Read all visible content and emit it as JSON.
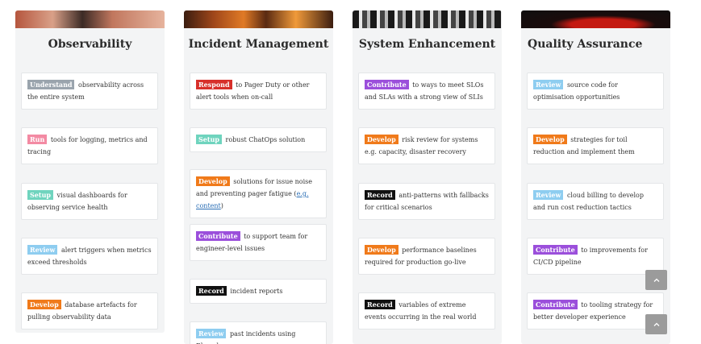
{
  "columns": [
    {
      "title": "Observability",
      "cards": [
        {
          "tag": "Understand",
          "text": "observability across the entire system"
        },
        {
          "tag": "Run",
          "text": "tools for logging, metrics and tracing"
        },
        {
          "tag": "Setup",
          "text": "visual dashboards for observing service health"
        },
        {
          "tag": "Review",
          "text": "alert triggers when metrics exceed thresholds"
        },
        {
          "tag": "Develop",
          "text": "database artefacts for pulling observability data"
        }
      ]
    },
    {
      "title": "Incident Management",
      "cards": [
        {
          "tag": "Respond",
          "text": "to Pager Duty or other alert tools when on-call"
        },
        {
          "tag": "Setup",
          "text": "robust ChatOps solution"
        },
        {
          "tag": "Develop",
          "text": "solutions for issue noise and preventing pager fatigue (",
          "link": "e.g. content",
          "text_after": ")"
        },
        {
          "tag": "Contribute",
          "text": "to support team for engineer-level issues"
        },
        {
          "tag": "Record",
          "text": "incident reports"
        },
        {
          "tag": "Review",
          "text": "past incidents using Blameless"
        }
      ]
    },
    {
      "title": "System Enhancement",
      "cards": [
        {
          "tag": "Contribute",
          "text": "to ways to meet SLOs and SLAs with a strong view of SLIs"
        },
        {
          "tag": "Develop",
          "text": "risk review for systems e.g. capacity, disaster recovery"
        },
        {
          "tag": "Record",
          "text": "anti-patterns with fallbacks for critical scenarios"
        },
        {
          "tag": "Develop",
          "text": "performance baselines required for production go-live"
        },
        {
          "tag": "Record",
          "text": "variables of extreme events occurring in the real world"
        }
      ]
    },
    {
      "title": "Quality Assurance",
      "cards": [
        {
          "tag": "Review",
          "text": "source code for optimisation opportunities"
        },
        {
          "tag": "Develop",
          "text": "strategies for toil reduction and implement them"
        },
        {
          "tag": "Review",
          "text": "cloud billing to develop and run cost reduction tactics"
        },
        {
          "tag": "Contribute",
          "text": "to improvements for CI/CD pipeline"
        },
        {
          "tag": "Contribute",
          "text": "to tooling strategy for better developer experience"
        }
      ]
    }
  ],
  "colors": {
    "understand": "#9aa4ad",
    "run": "#f38aa3",
    "setup": "#6fd4be",
    "review": "#8ecdf0",
    "develop": "#f07a1a",
    "respond": "#d72f2a",
    "contribute": "#9b4fdb",
    "record": "#111111"
  },
  "icons": {
    "scroll_up": "chevron-up-icon"
  }
}
